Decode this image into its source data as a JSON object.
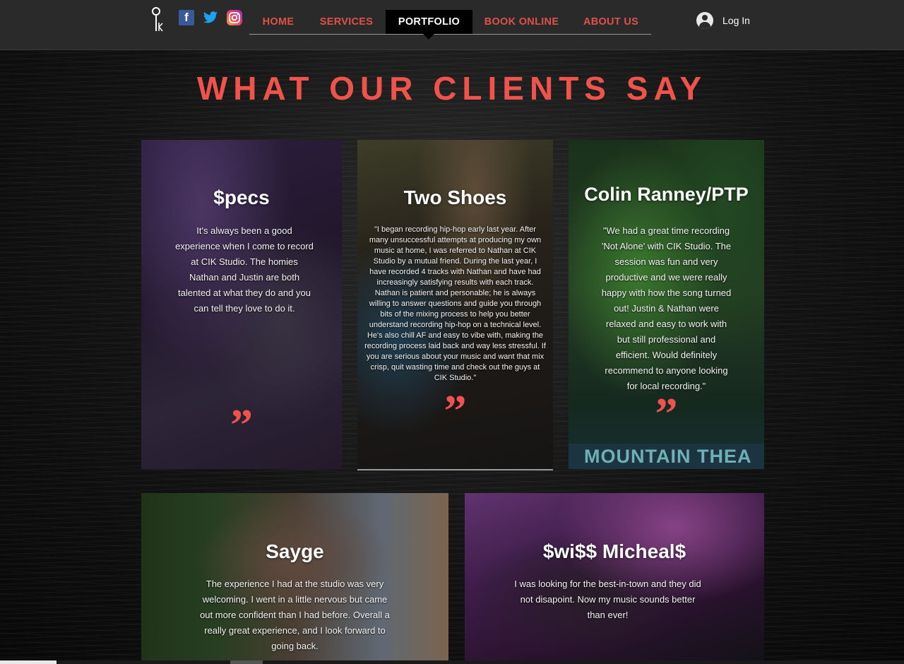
{
  "header": {
    "nav": [
      {
        "label": "HOME",
        "active": false
      },
      {
        "label": "SERVICES",
        "active": false
      },
      {
        "label": "PORTFOLIO",
        "active": true
      },
      {
        "label": "BOOK ONLINE",
        "active": false
      },
      {
        "label": "ABOUT US",
        "active": false
      }
    ],
    "social": [
      "facebook-icon",
      "twitter-icon",
      "instagram-icon"
    ],
    "login_label": "Log In"
  },
  "heading": "WHAT OUR CLIENTS SAY",
  "testimonials": [
    {
      "name": "$pecs",
      "text": "It's always been a good experience when I come to record at CIK Studio. The homies Nathan and Justin are both talented at what they do and you can tell they love to do it."
    },
    {
      "name": "Two Shoes",
      "text": "\"I began recording hip-hop early last year. After many unsuccessful attempts at producing my own music at home, I was referred to Nathan at CIK Studio by a mutual friend. During the last year, I have recorded 4 tracks with Nathan and have had increasingly satisfying results with each track. Nathan is patient and personable; he is always willing to answer questions and guide you through bits of the mixing process to help you better understand recording hip-hop on a technical level. He's also chill AF and easy to vibe with, making the recording process laid back and way less stressful. If you are serious about your music and want that mix crisp, quit wasting time and check out the guys at CIK Studio.\""
    },
    {
      "name": "Colin Ranney/PTP",
      "text": "\"We had a great time recording 'Not Alone' with CIK Studio. The session was fun and very productive and we were really happy with how the song turned out! Justin & Nathan were relaxed and easy to work with but still professional and efficient. Would definitely recommend to anyone looking for local recording.\"",
      "banner": "MOUNTAIN  THEA"
    },
    {
      "name": "Sayge",
      "text": "The experience I had at the studio was very welcoming. I went in a little nervous but came out more confident than I had before. Overall a really great experience, and I look forward to going back."
    },
    {
      "name": "$wi$$ Micheal$",
      "text": "I was looking for the best-in-town and they did not disapoint. Now my music sounds better than ever!"
    }
  ],
  "quote_mark": "”",
  "colors": {
    "accent": "#f0534c",
    "header": "#2a2a2a"
  }
}
